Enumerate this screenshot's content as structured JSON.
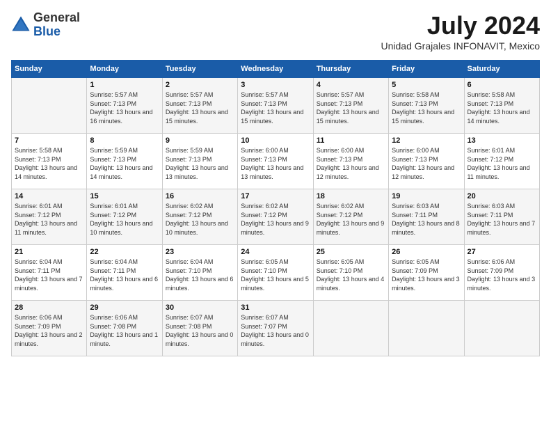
{
  "logo": {
    "general": "General",
    "blue": "Blue"
  },
  "header": {
    "month": "July 2024",
    "location": "Unidad Grajales INFONAVIT, Mexico"
  },
  "days_of_week": [
    "Sunday",
    "Monday",
    "Tuesday",
    "Wednesday",
    "Thursday",
    "Friday",
    "Saturday"
  ],
  "weeks": [
    [
      {
        "day": "",
        "sunrise": "",
        "sunset": "",
        "daylight": ""
      },
      {
        "day": "1",
        "sunrise": "Sunrise: 5:57 AM",
        "sunset": "Sunset: 7:13 PM",
        "daylight": "Daylight: 13 hours and 16 minutes."
      },
      {
        "day": "2",
        "sunrise": "Sunrise: 5:57 AM",
        "sunset": "Sunset: 7:13 PM",
        "daylight": "Daylight: 13 hours and 15 minutes."
      },
      {
        "day": "3",
        "sunrise": "Sunrise: 5:57 AM",
        "sunset": "Sunset: 7:13 PM",
        "daylight": "Daylight: 13 hours and 15 minutes."
      },
      {
        "day": "4",
        "sunrise": "Sunrise: 5:57 AM",
        "sunset": "Sunset: 7:13 PM",
        "daylight": "Daylight: 13 hours and 15 minutes."
      },
      {
        "day": "5",
        "sunrise": "Sunrise: 5:58 AM",
        "sunset": "Sunset: 7:13 PM",
        "daylight": "Daylight: 13 hours and 15 minutes."
      },
      {
        "day": "6",
        "sunrise": "Sunrise: 5:58 AM",
        "sunset": "Sunset: 7:13 PM",
        "daylight": "Daylight: 13 hours and 14 minutes."
      }
    ],
    [
      {
        "day": "7",
        "sunrise": "Sunrise: 5:58 AM",
        "sunset": "Sunset: 7:13 PM",
        "daylight": "Daylight: 13 hours and 14 minutes."
      },
      {
        "day": "8",
        "sunrise": "Sunrise: 5:59 AM",
        "sunset": "Sunset: 7:13 PM",
        "daylight": "Daylight: 13 hours and 14 minutes."
      },
      {
        "day": "9",
        "sunrise": "Sunrise: 5:59 AM",
        "sunset": "Sunset: 7:13 PM",
        "daylight": "Daylight: 13 hours and 13 minutes."
      },
      {
        "day": "10",
        "sunrise": "Sunrise: 6:00 AM",
        "sunset": "Sunset: 7:13 PM",
        "daylight": "Daylight: 13 hours and 13 minutes."
      },
      {
        "day": "11",
        "sunrise": "Sunrise: 6:00 AM",
        "sunset": "Sunset: 7:13 PM",
        "daylight": "Daylight: 13 hours and 12 minutes."
      },
      {
        "day": "12",
        "sunrise": "Sunrise: 6:00 AM",
        "sunset": "Sunset: 7:13 PM",
        "daylight": "Daylight: 13 hours and 12 minutes."
      },
      {
        "day": "13",
        "sunrise": "Sunrise: 6:01 AM",
        "sunset": "Sunset: 7:12 PM",
        "daylight": "Daylight: 13 hours and 11 minutes."
      }
    ],
    [
      {
        "day": "14",
        "sunrise": "Sunrise: 6:01 AM",
        "sunset": "Sunset: 7:12 PM",
        "daylight": "Daylight: 13 hours and 11 minutes."
      },
      {
        "day": "15",
        "sunrise": "Sunrise: 6:01 AM",
        "sunset": "Sunset: 7:12 PM",
        "daylight": "Daylight: 13 hours and 10 minutes."
      },
      {
        "day": "16",
        "sunrise": "Sunrise: 6:02 AM",
        "sunset": "Sunset: 7:12 PM",
        "daylight": "Daylight: 13 hours and 10 minutes."
      },
      {
        "day": "17",
        "sunrise": "Sunrise: 6:02 AM",
        "sunset": "Sunset: 7:12 PM",
        "daylight": "Daylight: 13 hours and 9 minutes."
      },
      {
        "day": "18",
        "sunrise": "Sunrise: 6:02 AM",
        "sunset": "Sunset: 7:12 PM",
        "daylight": "Daylight: 13 hours and 9 minutes."
      },
      {
        "day": "19",
        "sunrise": "Sunrise: 6:03 AM",
        "sunset": "Sunset: 7:11 PM",
        "daylight": "Daylight: 13 hours and 8 minutes."
      },
      {
        "day": "20",
        "sunrise": "Sunrise: 6:03 AM",
        "sunset": "Sunset: 7:11 PM",
        "daylight": "Daylight: 13 hours and 7 minutes."
      }
    ],
    [
      {
        "day": "21",
        "sunrise": "Sunrise: 6:04 AM",
        "sunset": "Sunset: 7:11 PM",
        "daylight": "Daylight: 13 hours and 7 minutes."
      },
      {
        "day": "22",
        "sunrise": "Sunrise: 6:04 AM",
        "sunset": "Sunset: 7:11 PM",
        "daylight": "Daylight: 13 hours and 6 minutes."
      },
      {
        "day": "23",
        "sunrise": "Sunrise: 6:04 AM",
        "sunset": "Sunset: 7:10 PM",
        "daylight": "Daylight: 13 hours and 6 minutes."
      },
      {
        "day": "24",
        "sunrise": "Sunrise: 6:05 AM",
        "sunset": "Sunset: 7:10 PM",
        "daylight": "Daylight: 13 hours and 5 minutes."
      },
      {
        "day": "25",
        "sunrise": "Sunrise: 6:05 AM",
        "sunset": "Sunset: 7:10 PM",
        "daylight": "Daylight: 13 hours and 4 minutes."
      },
      {
        "day": "26",
        "sunrise": "Sunrise: 6:05 AM",
        "sunset": "Sunset: 7:09 PM",
        "daylight": "Daylight: 13 hours and 3 minutes."
      },
      {
        "day": "27",
        "sunrise": "Sunrise: 6:06 AM",
        "sunset": "Sunset: 7:09 PM",
        "daylight": "Daylight: 13 hours and 3 minutes."
      }
    ],
    [
      {
        "day": "28",
        "sunrise": "Sunrise: 6:06 AM",
        "sunset": "Sunset: 7:09 PM",
        "daylight": "Daylight: 13 hours and 2 minutes."
      },
      {
        "day": "29",
        "sunrise": "Sunrise: 6:06 AM",
        "sunset": "Sunset: 7:08 PM",
        "daylight": "Daylight: 13 hours and 1 minute."
      },
      {
        "day": "30",
        "sunrise": "Sunrise: 6:07 AM",
        "sunset": "Sunset: 7:08 PM",
        "daylight": "Daylight: 13 hours and 0 minutes."
      },
      {
        "day": "31",
        "sunrise": "Sunrise: 6:07 AM",
        "sunset": "Sunset: 7:07 PM",
        "daylight": "Daylight: 13 hours and 0 minutes."
      },
      {
        "day": "",
        "sunrise": "",
        "sunset": "",
        "daylight": ""
      },
      {
        "day": "",
        "sunrise": "",
        "sunset": "",
        "daylight": ""
      },
      {
        "day": "",
        "sunrise": "",
        "sunset": "",
        "daylight": ""
      }
    ]
  ]
}
